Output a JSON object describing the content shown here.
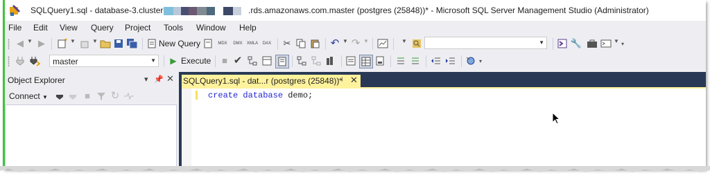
{
  "titlebar": {
    "left": "SQLQuery1.sql - database-3.cluster-",
    "right": ".rds.amazonaws.com.master (postgres (25848))* - Microsoft SQL Server Management Studio (Administrator)",
    "redaction_colors": [
      "#7fbfdd",
      "#b8c8d8",
      "#4a4f72",
      "#6b5872",
      "#7f8a93",
      "#4e6a7f",
      "#3d4766",
      "#c8d0dc"
    ]
  },
  "menu": [
    "File",
    "Edit",
    "View",
    "Query",
    "Project",
    "Tools",
    "Window",
    "Help"
  ],
  "toolbar1": {
    "new_query_label": "New Query",
    "icons": [
      "back-icon",
      "forward-icon",
      "new-project-icon",
      "add-item-icon",
      "open-file-icon",
      "save-icon",
      "save-all-icon",
      "new-query-icon",
      "mdx-query-icon",
      "dmx-query-icon",
      "xmla-query-icon",
      "dax-query-icon",
      "cut-icon",
      "copy-icon",
      "paste-icon",
      "undo-icon",
      "redo-icon",
      "activity-monitor-icon",
      "find-icon",
      "solution-explorer-icon",
      "properties-icon",
      "toolbox-icon",
      "command-window-icon"
    ]
  },
  "toolbar2": {
    "database": "master",
    "execute_label": "Execute",
    "icons": [
      "connect-icon",
      "change-connection-icon",
      "execute-icon",
      "parse-icon",
      "display-estimated-plan-icon",
      "query-designer-icon",
      "intellisense-icon",
      "include-actual-plan-icon",
      "live-query-stats-icon",
      "client-statistics-icon",
      "results-to-text-icon",
      "results-to-grid-icon",
      "results-to-file-icon",
      "comment-icon",
      "uncomment-icon",
      "decrease-indent-icon",
      "increase-indent-icon",
      "specify-values-icon"
    ]
  },
  "object_explorer": {
    "title": "Object Explorer",
    "connect_label": "Connect",
    "tree_items": []
  },
  "editor": {
    "tab_label": "SQLQuery1.sql - dat...r (postgres (25848))*",
    "code": {
      "keyword1": "create",
      "keyword2": "database",
      "rest": " demo;"
    }
  },
  "colors": {
    "accent_green": "#3fc43f",
    "chrome_bg": "#eeeef2",
    "editor_frame": "#293955",
    "active_tab": "#fff29d",
    "keyword": "#2424d6"
  }
}
